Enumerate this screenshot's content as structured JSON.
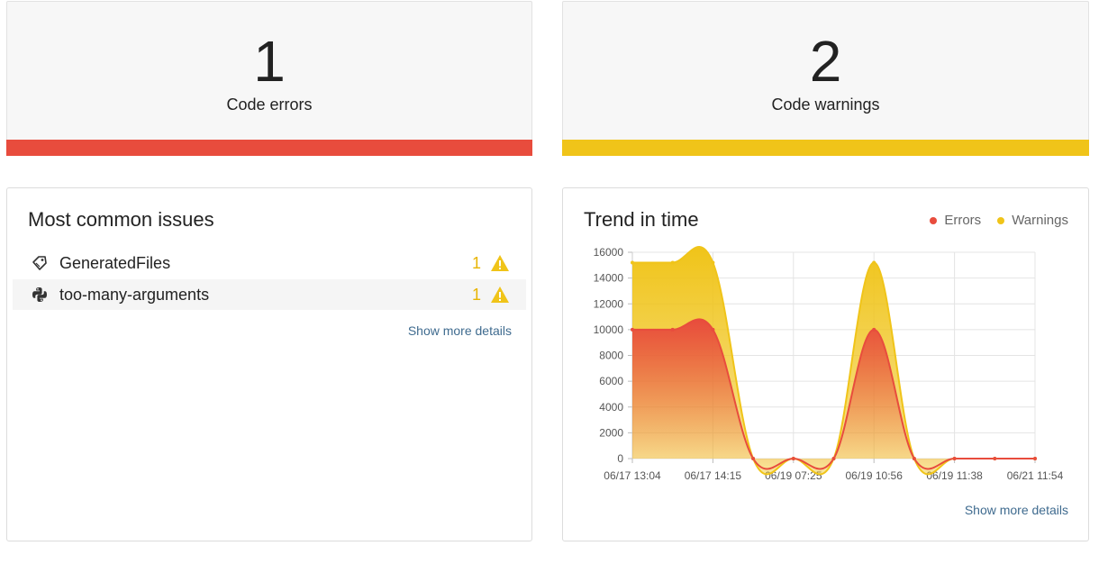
{
  "stats": {
    "errors": {
      "value": "1",
      "label": "Code errors",
      "color": "#e84c3d"
    },
    "warnings": {
      "value": "2",
      "label": "Code warnings",
      "color": "#f0c419"
    }
  },
  "issues_panel": {
    "title": "Most common issues",
    "items": [
      {
        "name": "GeneratedFiles",
        "count": "1",
        "icon": "tag-icon"
      },
      {
        "name": "too-many-arguments",
        "count": "1",
        "icon": "python-icon"
      }
    ],
    "more_link": "Show more details"
  },
  "trend_panel": {
    "title": "Trend in time",
    "legend": [
      {
        "label": "Errors",
        "color": "#e84c3d"
      },
      {
        "label": "Warnings",
        "color": "#f0c419"
      }
    ],
    "more_link": "Show more details"
  },
  "chart_data": {
    "type": "area",
    "stacked": true,
    "smooth": true,
    "grid": true,
    "legend_position": "top-right",
    "x": [
      "06/17 13:04",
      "",
      "06/17 14:15",
      "",
      "06/19 07:25",
      "",
      "06/19 10:56",
      "",
      "06/19 11:38",
      "",
      "06/21 11:54"
    ],
    "x_tick_labels": [
      "06/17 13:04",
      "06/17 14:15",
      "06/19 07:25",
      "06/19 10:56",
      "06/19 11:38",
      "06/21 11:54"
    ],
    "series": [
      {
        "name": "Errors",
        "color": "#e84c3d",
        "values": [
          10000,
          10000,
          10000,
          0,
          0,
          0,
          10000,
          0,
          0,
          0,
          0
        ]
      },
      {
        "name": "Warnings",
        "color": "#f0c419",
        "values": [
          5200,
          5200,
          5200,
          0,
          0,
          0,
          5200,
          0,
          0,
          0,
          0
        ]
      }
    ],
    "ylim": [
      0,
      16000
    ],
    "y_ticks": [
      0,
      2000,
      4000,
      6000,
      8000,
      10000,
      12000,
      14000,
      16000
    ]
  }
}
